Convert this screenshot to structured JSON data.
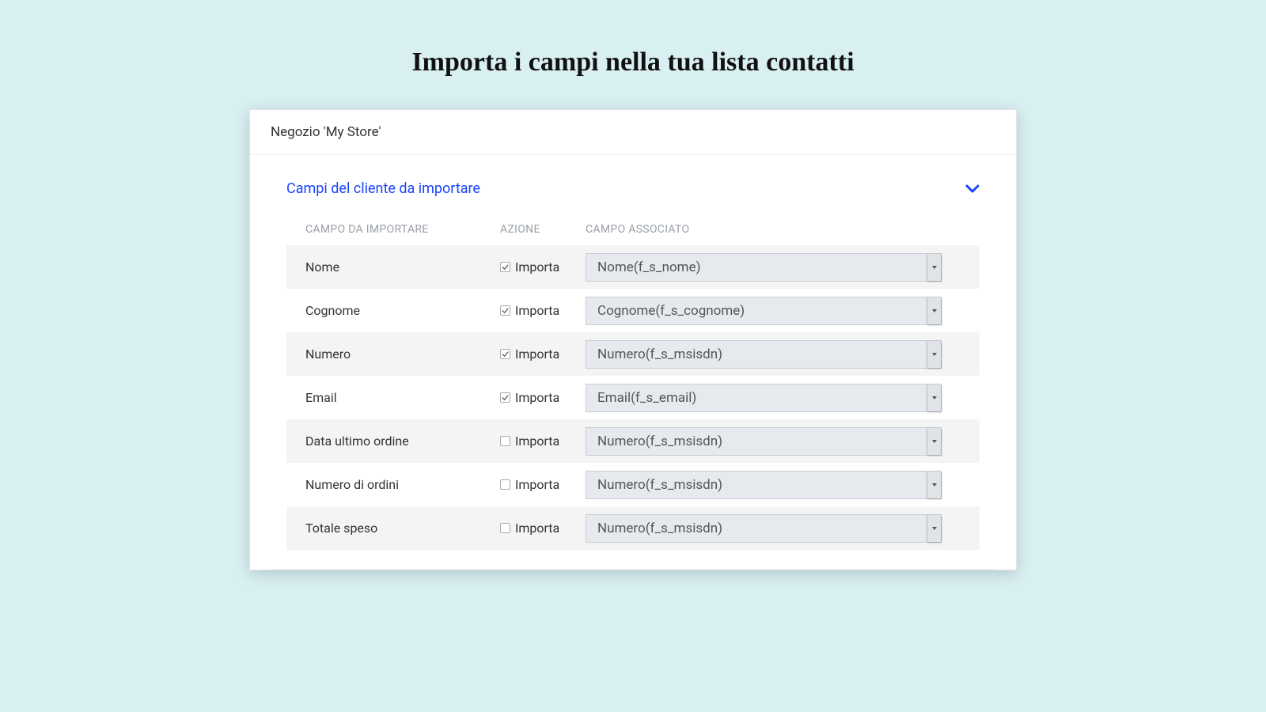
{
  "page": {
    "title": "Importa i campi nella tua lista contatti"
  },
  "card": {
    "storeLabel": "Negozio 'My Store'"
  },
  "section": {
    "title": "Campi del cliente da importare"
  },
  "table": {
    "headers": {
      "field": "CAMPO DA IMPORTARE",
      "action": "AZIONE",
      "associated": "CAMPO ASSOCIATO"
    },
    "actionLabel": "Importa",
    "rows": [
      {
        "field": "Nome",
        "checked": true,
        "associated": "Nome(f_s_nome)"
      },
      {
        "field": "Cognome",
        "checked": true,
        "associated": "Cognome(f_s_cognome)"
      },
      {
        "field": "Numero",
        "checked": true,
        "associated": "Numero(f_s_msisdn)"
      },
      {
        "field": "Email",
        "checked": true,
        "associated": "Email(f_s_email)"
      },
      {
        "field": "Data ultimo ordine",
        "checked": false,
        "associated": "Numero(f_s_msisdn)"
      },
      {
        "field": "Numero di ordini",
        "checked": false,
        "associated": "Numero(f_s_msisdn)"
      },
      {
        "field": "Totale speso",
        "checked": false,
        "associated": "Numero(f_s_msisdn)"
      }
    ]
  }
}
